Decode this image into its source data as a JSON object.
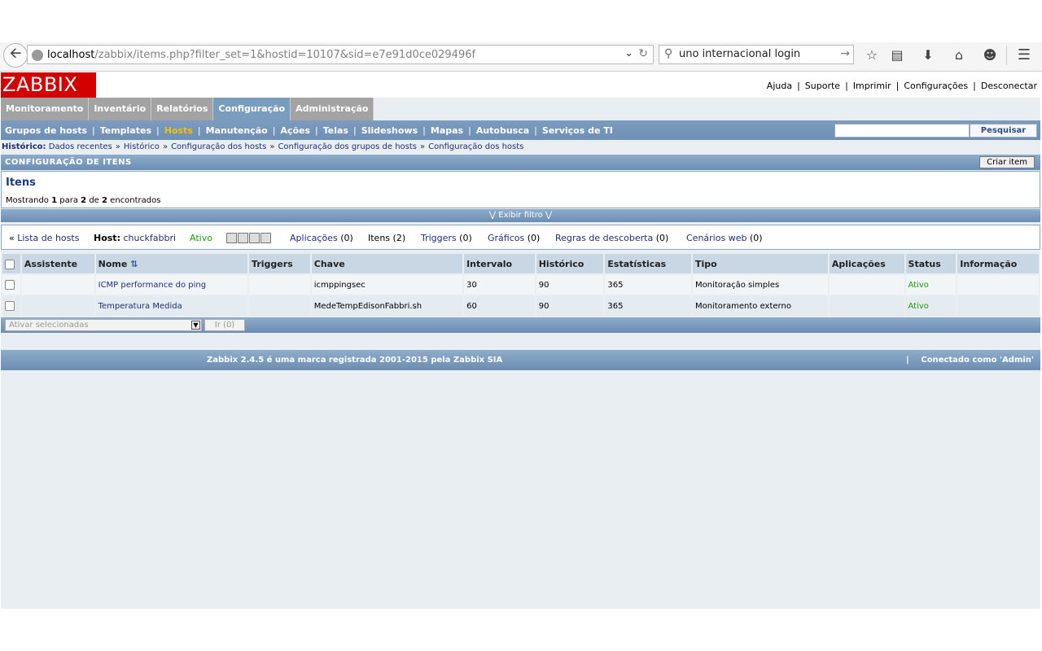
{
  "browser": {
    "url_host": "localhost",
    "url_path": "/zabbix/items.php?filter_set=1&hostid=10107&sid=e7e91d0ce029496f",
    "search_value": "uno internacional login"
  },
  "logo": "ZABBIX",
  "toplinks": [
    "Ajuda",
    "Suporte",
    "Imprimir",
    "Configurações",
    "Desconectar"
  ],
  "mainmenu": [
    "Monitoramento",
    "Inventário",
    "Relatórios",
    "Configuração",
    "Administração"
  ],
  "submenu": [
    "Grupos de hosts",
    "Templates",
    "Hosts",
    "Manutenção",
    "Ações",
    "Telas",
    "Slideshows",
    "Mapas",
    "Autobusca",
    "Serviços de TI"
  ],
  "search_button": "Pesquisar",
  "history": {
    "label": "Histórico:",
    "items": [
      "Dados recentes",
      "Histórico",
      "Configuração dos hosts",
      "Configuração dos grupos de hosts",
      "Configuração dos hosts"
    ]
  },
  "section_title": "CONFIGURAÇÃO DE ITENS",
  "create_button": "Criar item",
  "itens_title": "Itens",
  "count": {
    "prefix": "Mostrando",
    "from": "1",
    "para": "para",
    "to": "2",
    "de": "de",
    "total": "2",
    "suffix": "encontrados"
  },
  "filter_toggle": "Exibir filtro",
  "hostnav": {
    "back": "«",
    "list_hosts": "Lista de hosts",
    "host_label": "Host:",
    "host_name": "chuckfabbri",
    "status": "Ativo",
    "aplicacoes": "Aplicações",
    "aplicacoes_count": "(0)",
    "itens": "Itens (2)",
    "triggers": "Triggers",
    "triggers_count": "(0)",
    "graficos": "Gráficos",
    "graficos_count": "(0)",
    "regras": "Regras de descoberta",
    "regras_count": "(0)",
    "cenarios": "Cenários web",
    "cenarios_count": "(0)"
  },
  "table": {
    "headers": [
      "Assistente",
      "Nome",
      "Triggers",
      "Chave",
      "Intervalo",
      "Histórico",
      "Estatísticas",
      "Tipo",
      "Aplicações",
      "Status",
      "Informação"
    ],
    "rows": [
      {
        "nome": "ICMP performance do ping",
        "triggers": "",
        "chave": "icmppingsec",
        "intervalo": "30",
        "historico": "90",
        "estatisticas": "365",
        "tipo": "Monitoração simples",
        "aplicacoes": "",
        "status": "Ativo",
        "informacao": ""
      },
      {
        "nome": "Temperatura Medida",
        "triggers": "",
        "chave": "MedeTempEdisonFabbri.sh",
        "intervalo": "60",
        "historico": "90",
        "estatisticas": "365",
        "tipo": "Monitoramento externo",
        "aplicacoes": "",
        "status": "Ativo",
        "informacao": ""
      }
    ]
  },
  "bulk_select": "Ativar selecionadas",
  "bulk_go": "Ir (0)",
  "footer": {
    "copyright": "Zabbix 2.4.5 é uma marca registrada 2001-2015 pela Zabbix SIA",
    "separator": "|",
    "connected": "Conectado como 'Admin'"
  }
}
